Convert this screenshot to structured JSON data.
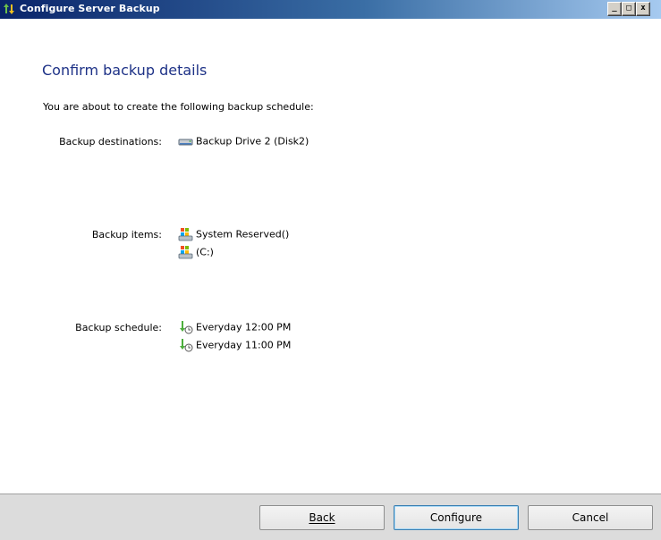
{
  "window": {
    "title": "Configure Server Backup",
    "controls": {
      "minimize": "_",
      "maximize": "□",
      "close": "x"
    }
  },
  "page": {
    "heading": "Confirm backup details",
    "intro": "You are about to create the following backup schedule:"
  },
  "destinations": {
    "label": "Backup destinations:",
    "items": [
      {
        "icon": "drive-icon",
        "text": "Backup Drive 2 (Disk2)"
      }
    ]
  },
  "items": {
    "label": "Backup items:",
    "items": [
      {
        "icon": "volume-icon",
        "text": "System Reserved()"
      },
      {
        "icon": "volume-icon",
        "text": "(C:)"
      }
    ]
  },
  "schedule": {
    "label": "Backup schedule:",
    "items": [
      {
        "icon": "schedule-icon",
        "text": "Everyday 12:00 PM"
      },
      {
        "icon": "schedule-icon",
        "text": "Everyday 11:00 PM"
      }
    ]
  },
  "buttons": {
    "back": "Back",
    "configure": "Configure",
    "cancel": "Cancel"
  }
}
